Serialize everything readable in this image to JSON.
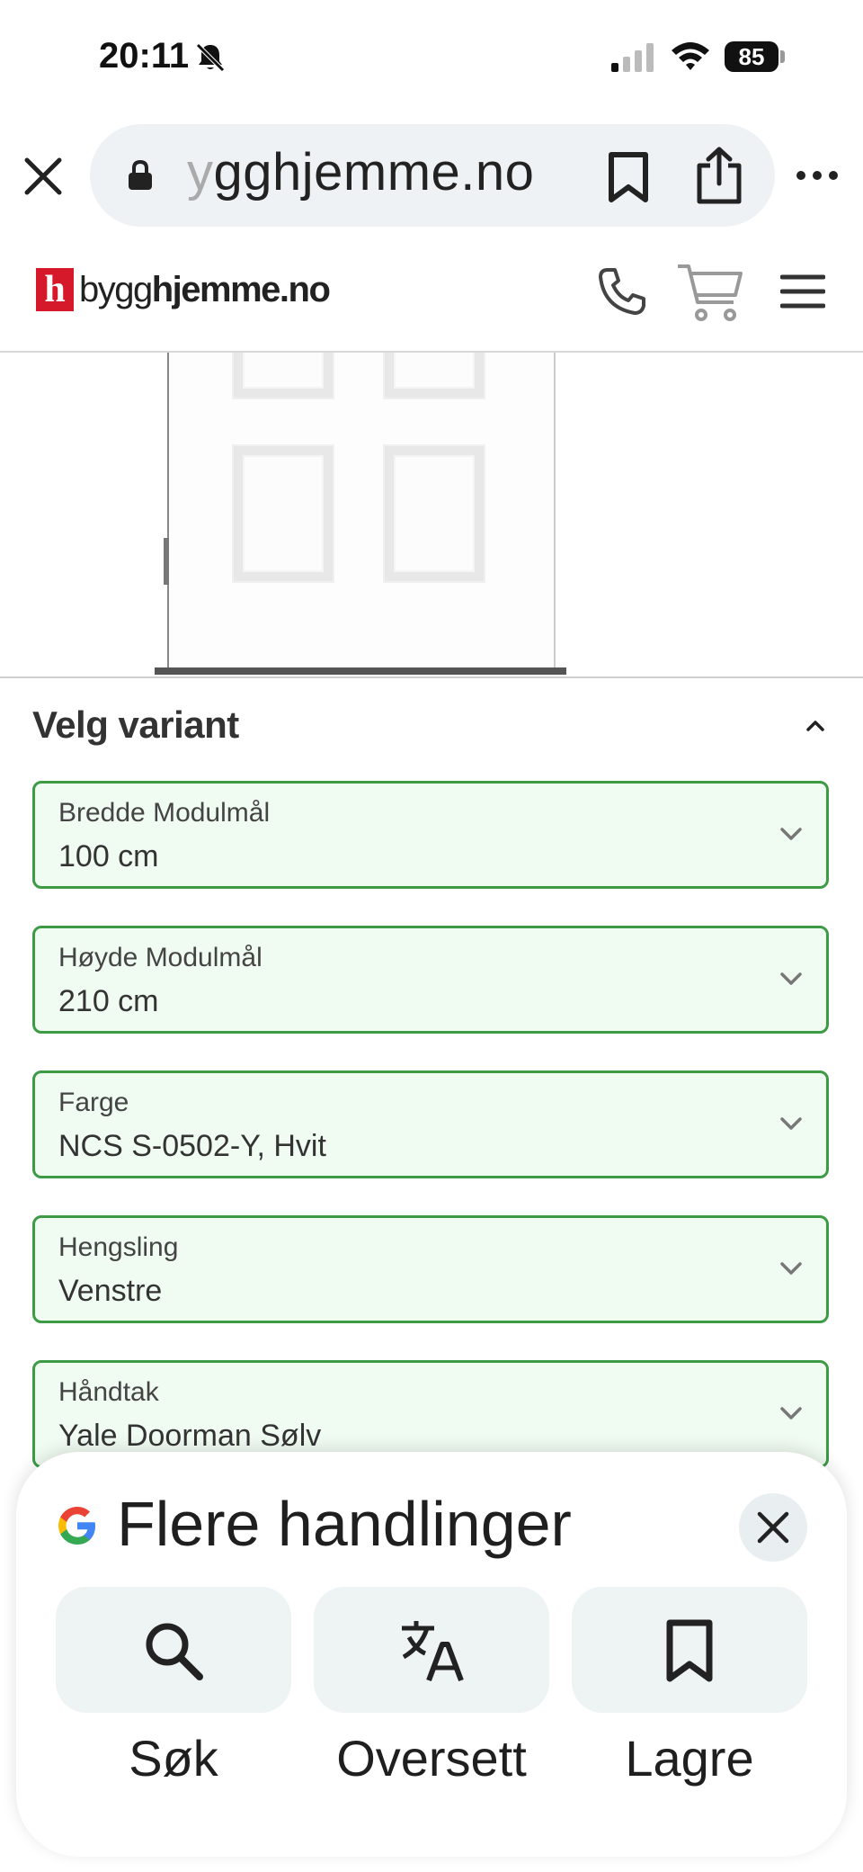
{
  "status_bar": {
    "time": "20:11",
    "battery": "85"
  },
  "browser": {
    "url_faded": "y",
    "url_text": "gghjemme.no"
  },
  "site": {
    "logo_mark": "h",
    "logo_part1": "bygg",
    "logo_part2": "hjemme.no"
  },
  "variant": {
    "title": "Velg variant",
    "fields": [
      {
        "label": "Bredde Modulmål",
        "value": "100 cm"
      },
      {
        "label": "Høyde Modulmål",
        "value": "210 cm"
      },
      {
        "label": "Farge",
        "value": "NCS S-0502-Y, Hvit"
      },
      {
        "label": "Hengsling",
        "value": "Venstre"
      },
      {
        "label": "Håndtak",
        "value": "Yale Doorman Sølv"
      }
    ]
  },
  "sheet": {
    "title": "Flere handlinger",
    "actions": [
      {
        "label": "Søk",
        "icon": "search-icon"
      },
      {
        "label": "Oversett",
        "icon": "translate-icon"
      },
      {
        "label": "Lagre",
        "icon": "bookmark-icon"
      }
    ]
  },
  "colors": {
    "accent_green": "#3d9a45",
    "field_bg": "#f0fbf1",
    "logo_red": "#d5182a"
  }
}
